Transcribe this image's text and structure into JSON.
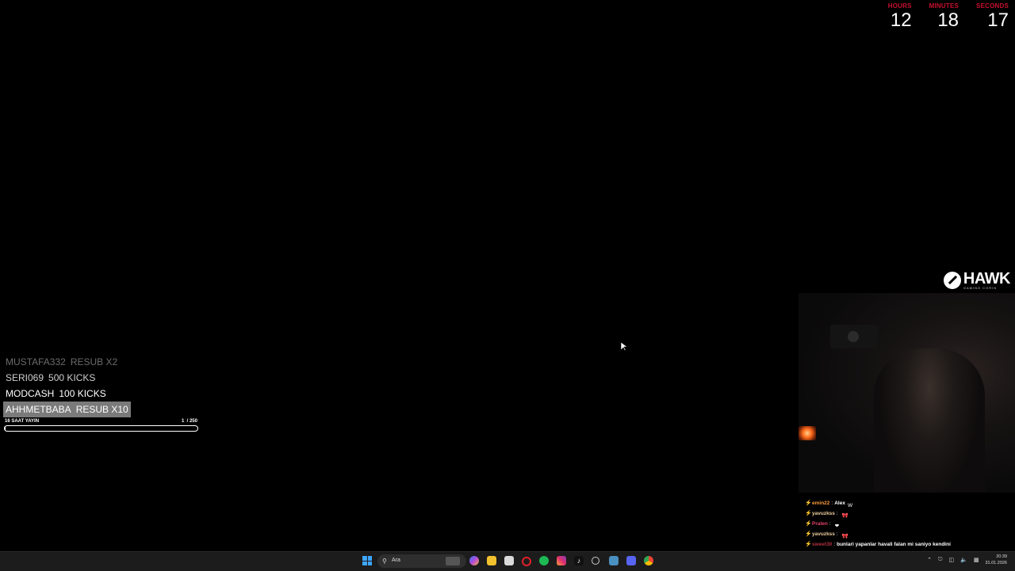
{
  "timer": {
    "hours_label": "HOURS",
    "hours": "12",
    "minutes_label": "MINUTES",
    "minutes": "18",
    "seconds_label": "SECONDS",
    "seconds": "17",
    "label_color": "#c8102e"
  },
  "events": [
    {
      "name": "MUSTAFA332",
      "action": "RESUB X2"
    },
    {
      "name": "SERI069",
      "action": "500 KICKS"
    },
    {
      "name": "MODCASH",
      "action": "100 KICKS"
    },
    {
      "name": "AHHMETBABA",
      "action": "RESUB X10"
    }
  ],
  "goal": {
    "title": "16 SAAT YAYIN",
    "current": "1",
    "total": "/ 250",
    "progress": 0.004
  },
  "logo": {
    "name": "HAWK",
    "tagline": "GAMING CORIN"
  },
  "chat": [
    {
      "user": "emin22",
      "user_color": "#ff9a3c",
      "text": "Alex",
      "emote": "W"
    },
    {
      "user": "yavuzkss",
      "user_color": "#f0d0a0",
      "text": "",
      "emote": "🎀"
    },
    {
      "user": "Pralen",
      "user_color": "#e0406a",
      "text": "",
      "emote": "❤"
    },
    {
      "user": "yavuzkss",
      "user_color": "#f0d0a0",
      "text": "",
      "emote": "🎀"
    },
    {
      "user": "sweet30",
      "user_color": "#b03040",
      "text": "bunlari yapanlar havali falan mi saniyo kendini",
      "emote": ""
    },
    {
      "user": "yavuzkss",
      "user_color": "#f0d0a0",
      "text": "",
      "emote": "🎀"
    }
  ],
  "taskbar": {
    "search_placeholder": "Ara",
    "time": "20:39",
    "date": "31.01.2026",
    "icons": [
      "copilot-icon",
      "file-explorer-icon",
      "store-icon",
      "opera-icon",
      "spotify-icon",
      "instagram-icon",
      "tiktok-icon",
      "github-icon",
      "app-icon",
      "discord-icon",
      "chrome-icon"
    ]
  }
}
